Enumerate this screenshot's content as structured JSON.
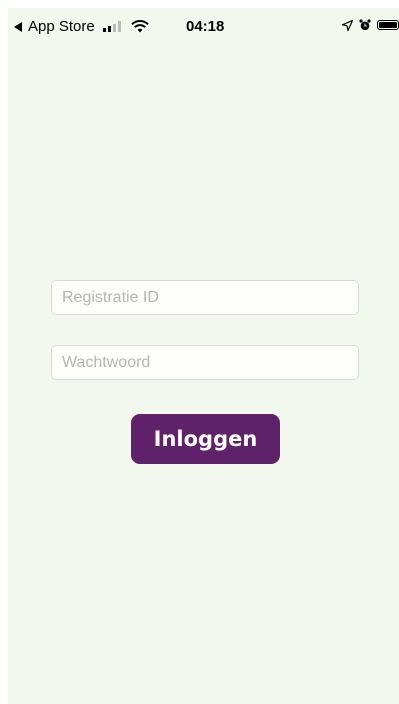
{
  "status_bar": {
    "back_app": "App Store",
    "time": "04:18"
  },
  "login": {
    "registration_placeholder": "Registratie ID",
    "password_placeholder": "Wachtwoord",
    "button_label": "Inloggen"
  },
  "colors": {
    "background": "#f3f8ef",
    "button": "#5f2169",
    "button_text": "#ffffff"
  },
  "icons": [
    "back-arrow-icon",
    "signal-icon",
    "wifi-icon",
    "location-icon",
    "alarm-icon",
    "battery-icon"
  ]
}
